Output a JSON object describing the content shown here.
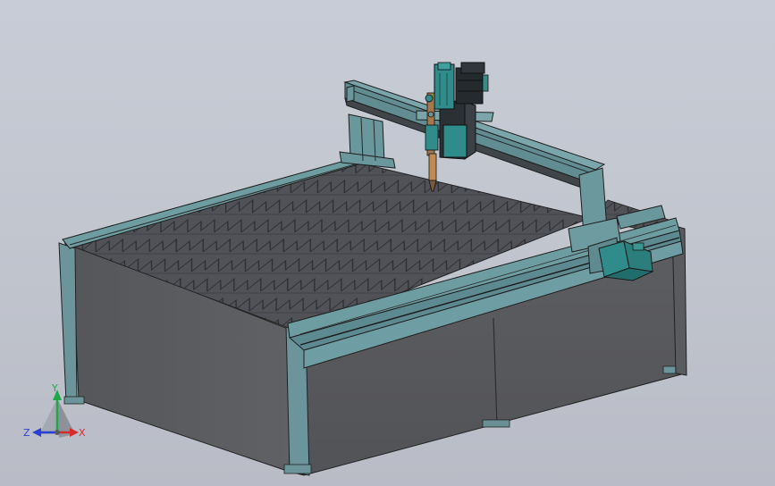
{
  "viewport": {
    "background": "#c4c8d1",
    "model": "cnc-plasma-cutting-table"
  },
  "triad": {
    "x_label": "X",
    "y_label": "Y",
    "z_label": "Z",
    "x_color": "#d62b2b",
    "y_color": "#1fa84a",
    "z_color": "#2a3fd6"
  },
  "colors": {
    "frame_dark": "#555559",
    "frame_mid": "#5f6064",
    "rail_teal": "#6c9aa0",
    "motor_teal": "#2f8c8a",
    "motor_dark": "#2a2e33",
    "slats": "#4d4f55"
  }
}
